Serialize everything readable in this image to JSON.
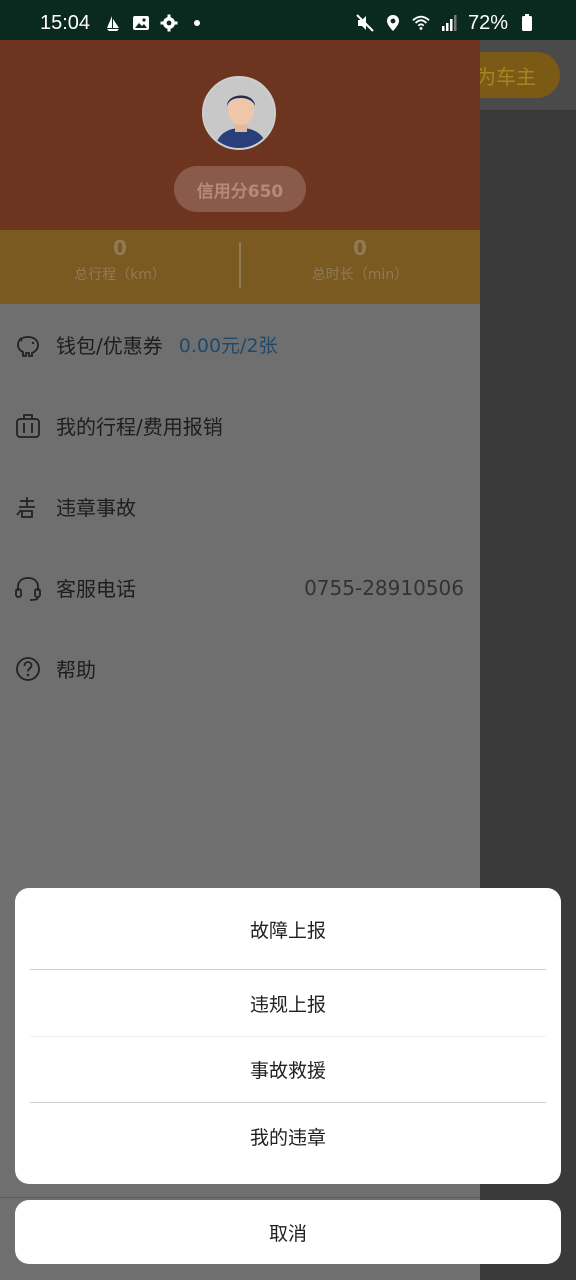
{
  "status_bar": {
    "time": "15:04",
    "battery": "72%",
    "icons_left": [
      "sailboat-icon",
      "image-icon",
      "gear-icon",
      "dot-icon"
    ],
    "icons_right": [
      "mute-icon",
      "location-icon",
      "wifi-icon",
      "signal-icon",
      "battery-icon"
    ]
  },
  "background": {
    "owner_button_label": "为车主"
  },
  "profile": {
    "credit_label": "信用分650",
    "stats": [
      {
        "value": "0",
        "label": "总行程（km）"
      },
      {
        "value": "0",
        "label": "总时长（min）"
      }
    ]
  },
  "menu": [
    {
      "icon": "piggy-bank-icon",
      "label": "钱包/优惠券",
      "extra": "0.00元/2张"
    },
    {
      "icon": "suitcase-icon",
      "label": "我的行程/费用报销"
    },
    {
      "icon": "violation-icon",
      "label": "违章事故"
    },
    {
      "icon": "headset-icon",
      "label": "客服电话",
      "right": "0755-28910506"
    },
    {
      "icon": "help-icon",
      "label": "帮助"
    }
  ],
  "sheet": {
    "options": [
      "故障上报",
      "违规上报",
      "事故救援",
      "我的违章"
    ],
    "cancel_label": "取消"
  },
  "colors": {
    "drawer_header": "#6d3520",
    "stats_bar": "#7a5a20",
    "link_blue": "#1b4a6e"
  }
}
